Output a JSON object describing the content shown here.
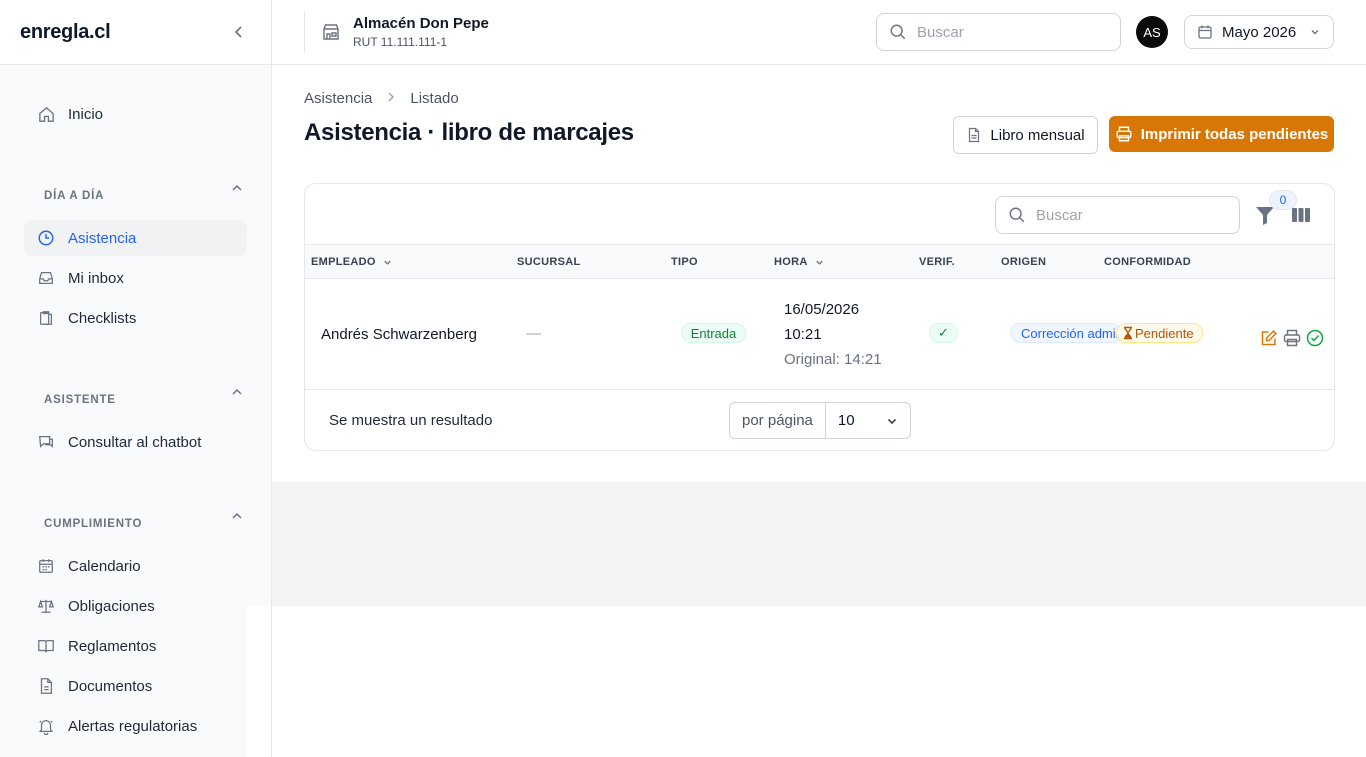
{
  "brand": "enregla.cl",
  "company": {
    "name": "Almacén Don Pepe",
    "rut": "RUT 11.111.111-1"
  },
  "header": {
    "search_placeholder": "Buscar",
    "avatar_initials": "AS",
    "period": "Mayo 2026"
  },
  "sidebar": {
    "home": "Inicio",
    "sections": [
      {
        "title": "DÍA A DÍA",
        "items": [
          "Asistencia",
          "Mi inbox",
          "Checklists"
        ]
      },
      {
        "title": "ASISTENTE",
        "items": [
          "Consultar al chatbot"
        ]
      },
      {
        "title": "CUMPLIMIENTO",
        "items": [
          "Calendario",
          "Obligaciones",
          "Reglamentos",
          "Documentos",
          "Alertas regulatorias"
        ]
      }
    ],
    "active_item": "Asistencia"
  },
  "breadcrumb": [
    "Asistencia",
    "Listado"
  ],
  "page_title": "Asistencia · libro de marcajes",
  "actions": {
    "monthly_book": "Libro mensual",
    "print_pending": "Imprimir todas pendientes"
  },
  "table": {
    "search_placeholder": "Buscar",
    "filter_count": "0",
    "columns": [
      "EMPLEADO",
      "SUCURSAL",
      "TIPO",
      "HORA",
      "VERIF.",
      "ORIGEN",
      "CONFORMIDAD"
    ],
    "rows": [
      {
        "employee": "Andrés Schwarzenberg",
        "branch": "—",
        "type": "Entrada",
        "date": "16/05/2026",
        "time": "10:21",
        "original": "Original: 14:21",
        "verified": "✓",
        "origin": "Corrección admin",
        "conformity": "Pendiente"
      }
    ],
    "footer": {
      "result_text": "Se muestra un resultado",
      "per_page_label": "por página",
      "per_page_value": "10"
    }
  },
  "colors": {
    "accent": "#2563eb",
    "primary_button": "#d97706",
    "success": "#16a34a"
  }
}
